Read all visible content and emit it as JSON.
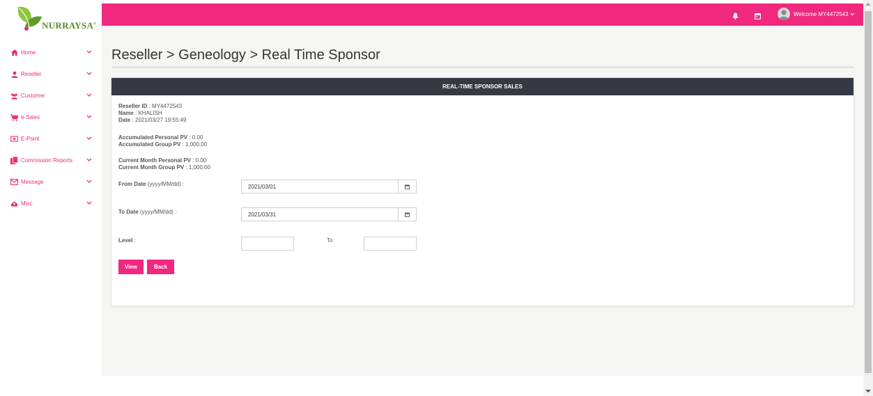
{
  "brand": {
    "name": "NURRAYSA",
    "trademark": "®",
    "primary_color": "#f0287f",
    "header_dark": "#373942"
  },
  "sidebar": {
    "items": [
      {
        "label": "Home",
        "icon": "home-icon"
      },
      {
        "label": "Reseller",
        "icon": "user-icon"
      },
      {
        "label": "Customer",
        "icon": "users-icon"
      },
      {
        "label": "e-Sales",
        "icon": "cart-icon"
      },
      {
        "label": "E-Point",
        "icon": "money-icon"
      },
      {
        "label": "Commission Reports",
        "icon": "files-icon"
      },
      {
        "label": "Message",
        "icon": "envelope-icon"
      },
      {
        "label": "Misc",
        "icon": "cloud-icon"
      }
    ]
  },
  "topbar": {
    "welcome": "Welcome MY4472543"
  },
  "page": {
    "title": "Reseller > Geneology > Real Time Sponsor"
  },
  "card": {
    "title": "REAL-TIME SPONSOR SALES",
    "reseller_id_label": "Reseller ID",
    "reseller_id": " : MY4472543",
    "name_label": "Name",
    "name": " : KHALISH",
    "date_label": "Date",
    "date": " : 2021/03/27 19:55:49",
    "acc_personal_label": "Accumulated Personal PV",
    "acc_personal": " : 0.00",
    "acc_group_label": "Accumulated Group PV",
    "acc_group": " : 1,000.00",
    "cur_personal_label": "Current Month Personal PV",
    "cur_personal": " : 0.00",
    "cur_group_label": "Current Month Group PV",
    "cur_group": " : 1,000.00"
  },
  "form": {
    "from_label": "From Date",
    "from_hint": " (yyyy/MM/dd) :",
    "from_value": "2021/03/01",
    "to_label": "To Date",
    "to_hint": " (yyyy/MM/dd) :",
    "to_value": "2021/03/31",
    "level_label": "Level",
    "level_colon": " :",
    "level_to": "To",
    "level_from_value": "",
    "level_to_value": "",
    "view_button": "View",
    "back_button": "Back"
  }
}
